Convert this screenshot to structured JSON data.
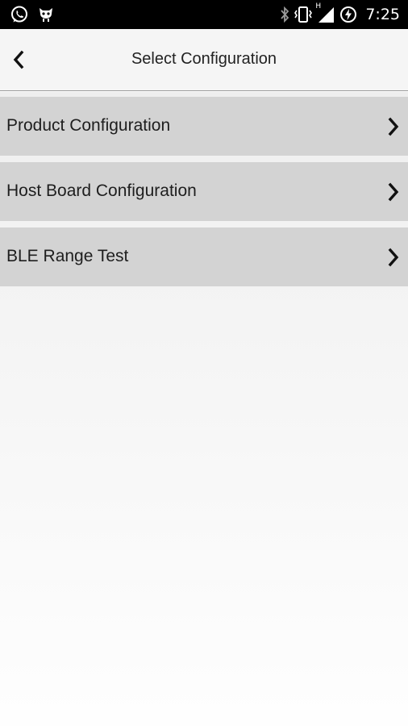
{
  "status_bar": {
    "time": "7:25",
    "left_icons": [
      "whatsapp-icon",
      "alien-notification-icon"
    ],
    "right_icons": [
      "bluetooth-icon",
      "vibrate-icon",
      "signal-h-icon",
      "data-saver-icon"
    ],
    "network_type": "H"
  },
  "header": {
    "title": "Select Configuration",
    "back_icon": "chevron-left-icon"
  },
  "menu": {
    "items": [
      {
        "label": "Product Configuration"
      },
      {
        "label": "Host Board Configuration"
      },
      {
        "label": "BLE Range Test"
      }
    ]
  },
  "colors": {
    "status_bar_bg": "#000000",
    "header_bg": "#f5f5f5",
    "menu_item_bg": "#d3d3d3",
    "text": "#222222"
  }
}
